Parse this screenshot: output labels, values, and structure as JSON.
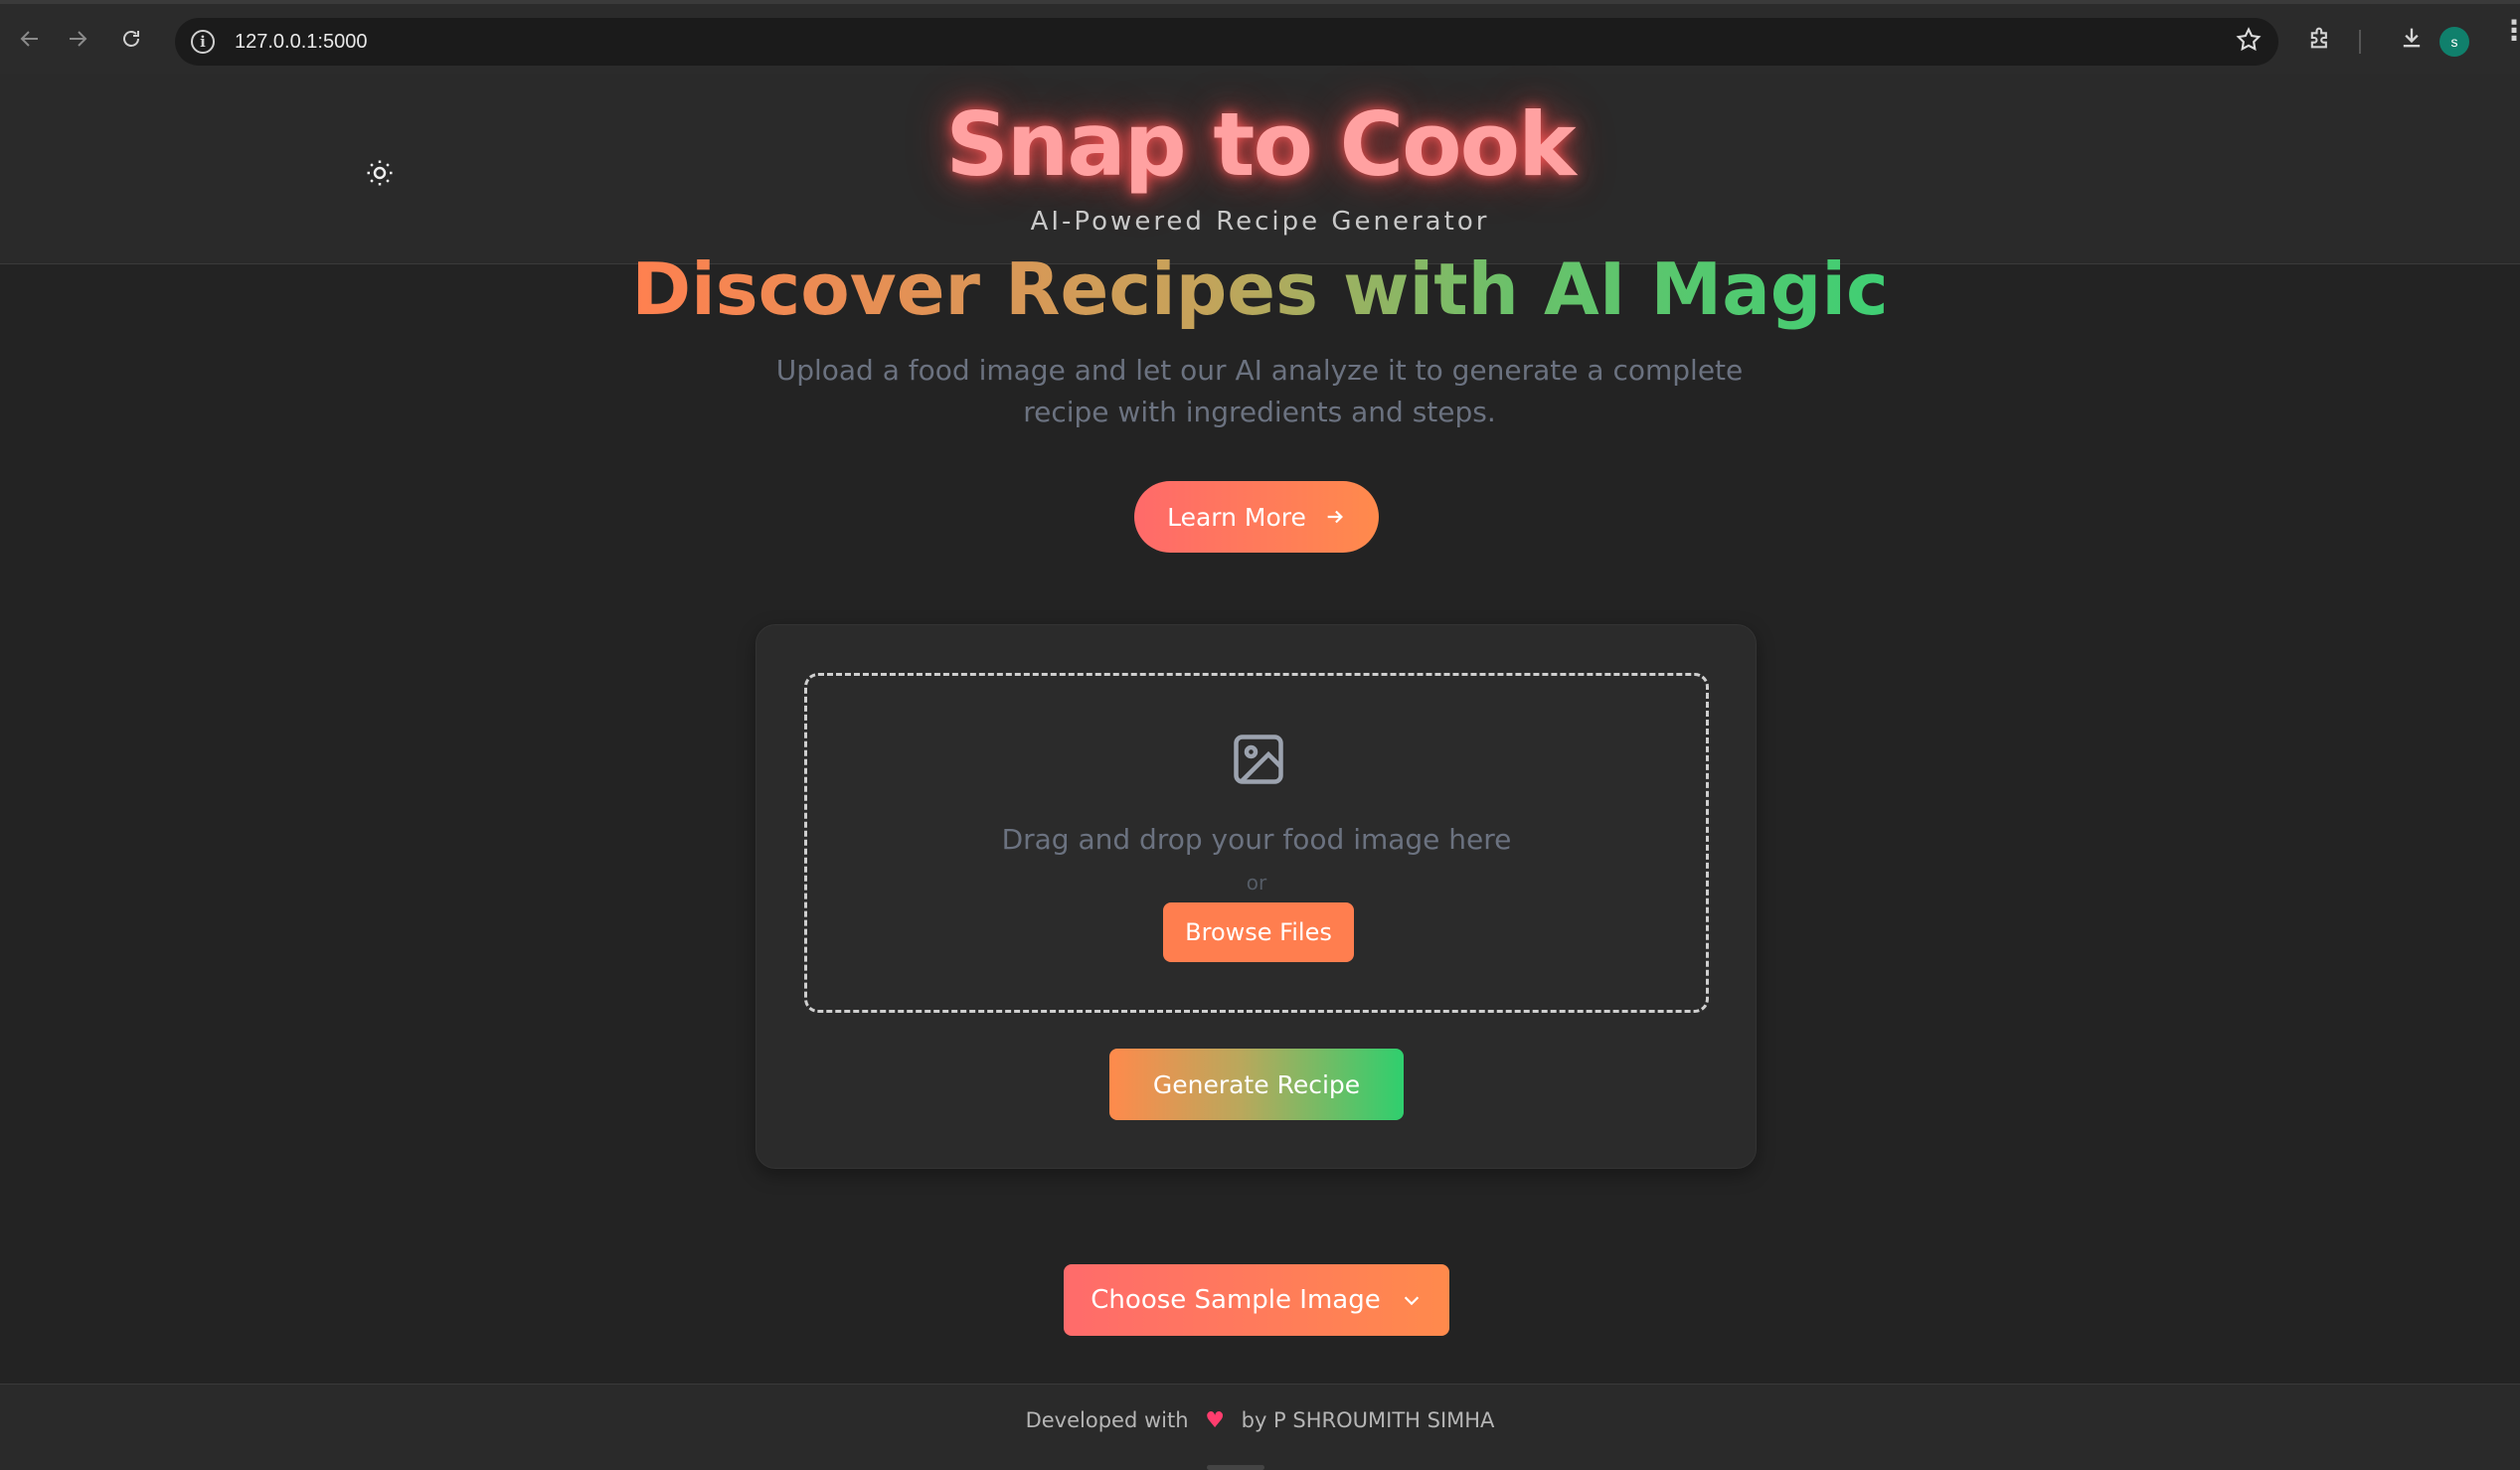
{
  "browser": {
    "url": "127.0.0.1:5000",
    "profile_initial": "s",
    "icons": {
      "back": "arrow-left-icon",
      "forward": "arrow-right-icon",
      "reload": "reload-icon",
      "site_info": "info-icon",
      "bookmark": "star-icon",
      "extensions": "puzzle-icon",
      "downloads": "download-icon",
      "menu": "kebab-menu-icon"
    }
  },
  "header": {
    "title": "Snap to Cook",
    "subtitle": "AI-Powered Recipe Generator",
    "theme_toggle_icon": "sun-icon"
  },
  "hero": {
    "title": "Discover Recipes with AI Magic",
    "description": "Upload a food image and let our AI analyze it to generate a complete recipe with ingredients and steps.",
    "learn_more_label": "Learn More"
  },
  "upload": {
    "drop_text": "Drag and drop your food image here",
    "or_text": "or",
    "browse_label": "Browse Files",
    "generate_label": "Generate Recipe"
  },
  "sample": {
    "label": "Choose Sample Image"
  },
  "footer": {
    "prefix": "Developed with",
    "suffix": "by P SHROUMITH SIMHA"
  },
  "colors": {
    "background": "#232323",
    "header_bg": "#2a2a2a",
    "brand_glow": "#ff5a5a",
    "accent_orange": "#ff7e4f",
    "accent_green": "#2fcf6e",
    "heart": "#ff3d6e"
  }
}
